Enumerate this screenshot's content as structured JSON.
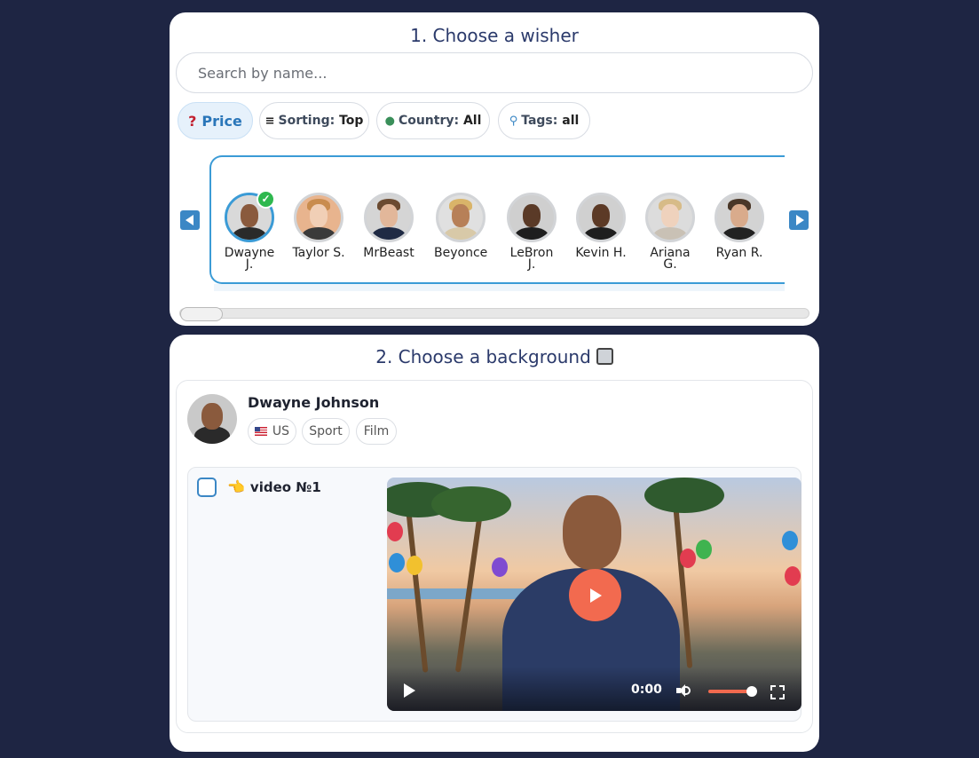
{
  "section1": {
    "title": "1. Choose a wisher",
    "search_placeholder": "Search by name...",
    "filters": {
      "price": {
        "icon": "question-icon",
        "label": "Price"
      },
      "sorting": {
        "icon": "hamburger-icon",
        "key": "Sorting:",
        "value": "Top"
      },
      "country": {
        "icon": "globe-icon",
        "key": "Country:",
        "value": "All"
      },
      "tags": {
        "icon": "magnifier-icon",
        "key": "Tags:",
        "value": "all"
      }
    },
    "wishers": [
      {
        "name": "Dwayne J.",
        "selected": true
      },
      {
        "name": "Taylor S.",
        "selected": false
      },
      {
        "name": "MrBeast",
        "selected": false
      },
      {
        "name": "Beyonce",
        "selected": false
      },
      {
        "name": "LeBron J.",
        "selected": false
      },
      {
        "name": "Kevin H.",
        "selected": false
      },
      {
        "name": "Ariana G.",
        "selected": false
      },
      {
        "name": "Ryan R.",
        "selected": false
      }
    ]
  },
  "section2": {
    "title": "2. Choose a background",
    "title_icon": "checkbox-square-icon",
    "profile": {
      "name": "Dwayne Johnson",
      "tags": [
        {
          "label": "US",
          "icon": "us-flag-icon"
        },
        {
          "label": "Sport"
        },
        {
          "label": "Film"
        }
      ]
    },
    "video": {
      "hand": "👈",
      "label": "video №1",
      "time": "0:00",
      "volume_level": 0.85
    }
  },
  "colors": {
    "background": "#1e2543",
    "accent": "#3b87c5",
    "play_button": "#f26a4f",
    "selected_check": "#2fb84f"
  }
}
